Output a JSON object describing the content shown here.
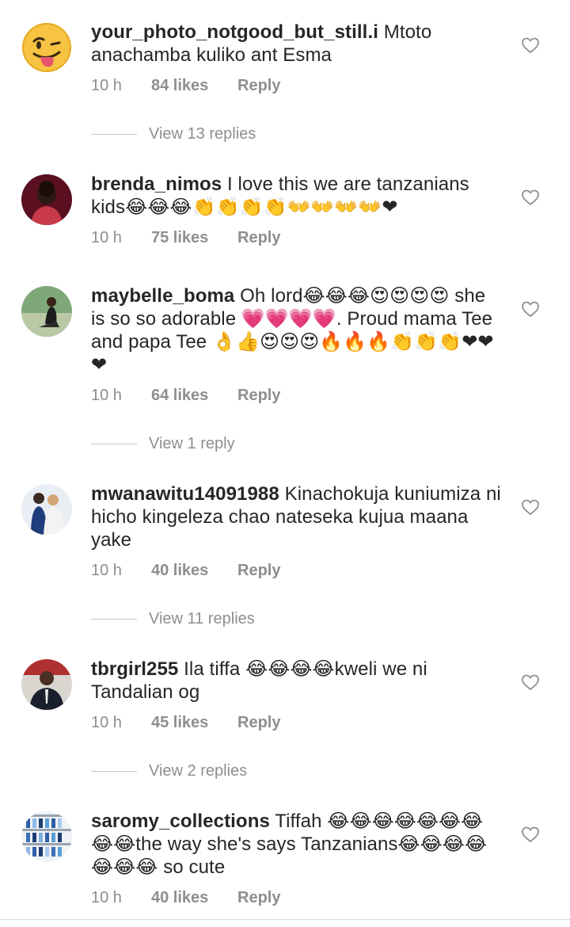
{
  "comments": [
    {
      "username": "your_photo_notgood_but_still.i",
      "text": " Mtoto anachamba kuliko ant Esma",
      "time": "10 h",
      "likes": "84 likes",
      "reply": "Reply",
      "view_replies": "View 13 replies",
      "avatar_icon": "winking-face-tongue-emoji"
    },
    {
      "username": "brenda_nimos",
      "text": " I love this we are tanzanians kids😂😂😂👏👏👏👏👐👐👐👐❤",
      "time": "10 h",
      "likes": "75 likes",
      "reply": "Reply",
      "view_replies": "",
      "avatar_icon": "user-photo"
    },
    {
      "username": "maybelle_boma",
      "text": " Oh lord😂😂😂😍😍😍😍 she is so so adorable 💗💗💗💗. Proud mama Tee and papa Tee 👌👍😍😍😍🔥🔥🔥👏👏👏❤❤❤",
      "time": "10 h",
      "likes": "64 likes",
      "reply": "Reply",
      "view_replies": "View 1 reply",
      "avatar_icon": "user-photo"
    },
    {
      "username": "mwanawitu14091988",
      "text": " Kinachokuja kuniumiza ni hicho kingeleza chao nateseka kujua maana yake",
      "time": "10 h",
      "likes": "40 likes",
      "reply": "Reply",
      "view_replies": "View 11 replies",
      "avatar_icon": "user-photo"
    },
    {
      "username": "tbrgirl255",
      "text": " Ila tiffa 😂😂😂😂kweli we ni Tandalian og",
      "time": "10 h",
      "likes": "45 likes",
      "reply": "Reply",
      "view_replies": "View 2 replies",
      "avatar_icon": "user-photo"
    },
    {
      "username": "saromy_collections",
      "text": " Tiffah 😂😂😂😂😂😂😂😂😂the way she's says Tanzanians😂😂😂😂😂😂😂 so cute",
      "time": "10 h",
      "likes": "40 likes",
      "reply": "Reply",
      "view_replies": "",
      "avatar_icon": "user-photo"
    }
  ],
  "icons": {
    "like": "heart-outline-icon"
  },
  "colors": {
    "text": "#262626",
    "secondary": "#8e8e8e",
    "divider": "#c7c7c7"
  }
}
